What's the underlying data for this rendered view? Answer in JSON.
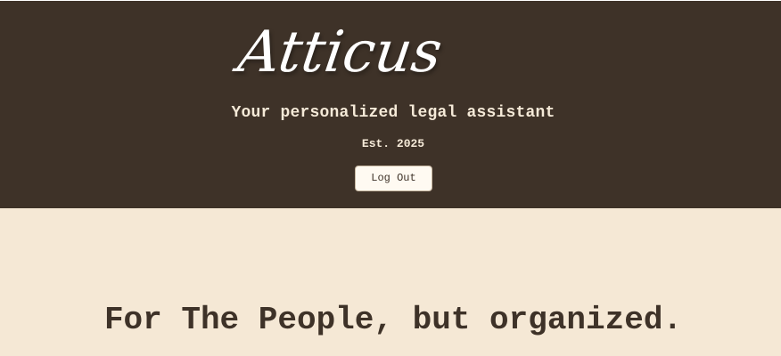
{
  "header": {
    "logo_text": "Atticus",
    "tagline": "Your personalized legal assistant",
    "established": "Est. 2025",
    "logout_label": "Log Out"
  },
  "main": {
    "hero_title": "For The People, but organized."
  },
  "colors": {
    "header_background": "#3e3228",
    "page_background": "#f5e8d5",
    "header_text": "#f5ead8",
    "button_background": "#fffaf2",
    "body_text": "#3e3228"
  }
}
